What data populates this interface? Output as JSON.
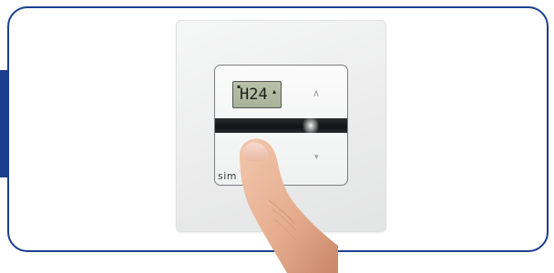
{
  "display": {
    "lcd_text": "H24",
    "indicator": "▴"
  },
  "icons": {
    "up": "up-arrow-icon",
    "down": "down-arrow-icon"
  },
  "brand": {
    "label": "sim"
  },
  "colors": {
    "frame_border": "#1c3d8f",
    "lcd_background": "#b3bba3",
    "device_band": "#151617"
  }
}
